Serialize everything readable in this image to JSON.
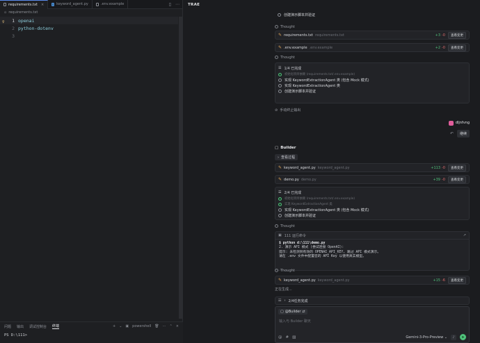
{
  "editor": {
    "tabs": [
      {
        "label": "requirements.txt",
        "active": true
      },
      {
        "label": "keyword_agent.py",
        "active": false
      },
      {
        "label": ".env.example",
        "active": false
      }
    ],
    "breadcrumb": "requirements.txt",
    "lines": [
      {
        "num": "1",
        "text": "openai"
      },
      {
        "num": "2",
        "text": "python-dotenv"
      },
      {
        "num": "3",
        "text": ""
      }
    ]
  },
  "panel": {
    "tabs": [
      "问题",
      "输出",
      "调试控制台",
      "终端"
    ],
    "active_tab": "终端",
    "terminal_name": "powershell",
    "prompt": "PS D:\\111>"
  },
  "app": {
    "brand": "TRAE"
  },
  "chat": {
    "top_todo": "创建演示脚本并验证",
    "thought_label": "Thought",
    "file1": {
      "name": "requirements.txt",
      "path": "requirements.txt",
      "plus": "+3",
      "minus": "-0",
      "action": "查看变更"
    },
    "file2": {
      "name": ".env.example",
      "path": ".env.example",
      "plus": "+2",
      "minus": "-0",
      "action": "查看变更"
    },
    "todo1": {
      "progress": "1/4 已完成",
      "items": [
        {
          "text": "初始化项目依赖 (requirements.txt/.env.example)",
          "done": true
        },
        {
          "text": "实现 KeywordExtractionAgent 类 (包含 Mock 模式)",
          "done": false
        },
        {
          "text": "实现 KeywordExtractionAgent 类",
          "done": false
        },
        {
          "text": "创建演示脚本并验证",
          "done": false
        }
      ]
    },
    "stopped": "手动终止输出",
    "user": {
      "name": "dljnfvng",
      "message": "继续"
    },
    "builder_label": "Builder",
    "collapse_label": "查看过程",
    "file3": {
      "name": "keyword_agent.py",
      "path": "keyword_agent.py",
      "plus": "+113",
      "minus": "-0",
      "action": "查看变更"
    },
    "file4": {
      "name": "demo.py",
      "path": "demo.py",
      "plus": "+39",
      "minus": "-0",
      "action": "查看变更"
    },
    "todo2": {
      "progress": "2/4 已完成",
      "items": [
        {
          "text": "初始化项目依赖 (requirements.txt/.env.example)",
          "done": true
        },
        {
          "text": "实现 KeywordExtractionAgent 类",
          "done": true
        },
        {
          "text": "实现 KeywordExtractionAgent 类 (包含 Mock 模式)",
          "done": false
        },
        {
          "text": "创建演示脚本并验证",
          "done": false
        }
      ]
    },
    "command": {
      "header": "111  运行命令",
      "cmd": "$ python d:\\111\\demo.py",
      "out1": "2. 演示 API 模式 (尝试连接 OpenAI):",
      "out2": "提示: 未检测到有效的 OPENAI_API_KEY, 跳过 API 模式演示。",
      "out3": "请在 .env 文件中配置您的 API Key 以使用真实模型。"
    },
    "file5": {
      "name": "keyword_agent.py",
      "path": "keyword_agent.py",
      "plus": "+15",
      "minus": "-6",
      "action": "查看变更"
    },
    "generating": "正在生成...",
    "tasks": "2/4任务完成",
    "input": {
      "chip": "@Builder",
      "placeholder": "输入与 Builder 聊天",
      "model": "Gemini-3-Pro-Preview"
    }
  },
  "colors": {
    "accent": "#4fc17a",
    "deletion": "#e06c6c",
    "file_icon": "#e0a458"
  }
}
